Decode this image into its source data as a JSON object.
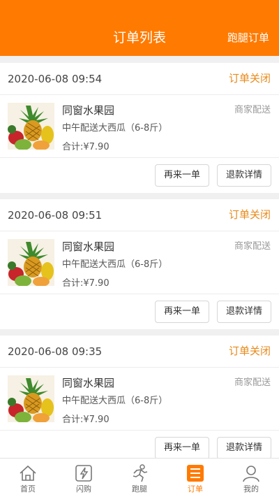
{
  "header": {
    "title": "订单列表",
    "right_link": "跑腿订单"
  },
  "orders": [
    {
      "time": "2020-06-08 09:54",
      "status": "订单关闭",
      "shop": "同窗水果园",
      "delivery": "商家配送",
      "item": "中午配送大西瓜（6-8斤）",
      "total": "合计:¥7.90",
      "btn_again": "再来一单",
      "btn_refund": "退款详情"
    },
    {
      "time": "2020-06-08 09:51",
      "status": "订单关闭",
      "shop": "同窗水果园",
      "delivery": "商家配送",
      "item": "中午配送大西瓜（6-8斤）",
      "total": "合计:¥7.90",
      "btn_again": "再来一单",
      "btn_refund": "退款详情"
    },
    {
      "time": "2020-06-08 09:35",
      "status": "订单关闭",
      "shop": "同窗水果园",
      "delivery": "商家配送",
      "item": "中午配送大西瓜（6-8斤）",
      "total": "合计:¥7.90",
      "btn_again": "再来一单",
      "btn_refund": "退款详情"
    }
  ],
  "tabbar": {
    "items": [
      {
        "label": "首页",
        "icon": "home-icon"
      },
      {
        "label": "闪购",
        "icon": "flash-icon"
      },
      {
        "label": "跑腿",
        "icon": "runner-icon"
      },
      {
        "label": "订单",
        "icon": "order-list-icon",
        "active": true
      },
      {
        "label": "我的",
        "icon": "user-icon"
      }
    ]
  },
  "colors": {
    "brand": "#ff7a00",
    "status": "#e88a1a",
    "muted": "#999999"
  }
}
